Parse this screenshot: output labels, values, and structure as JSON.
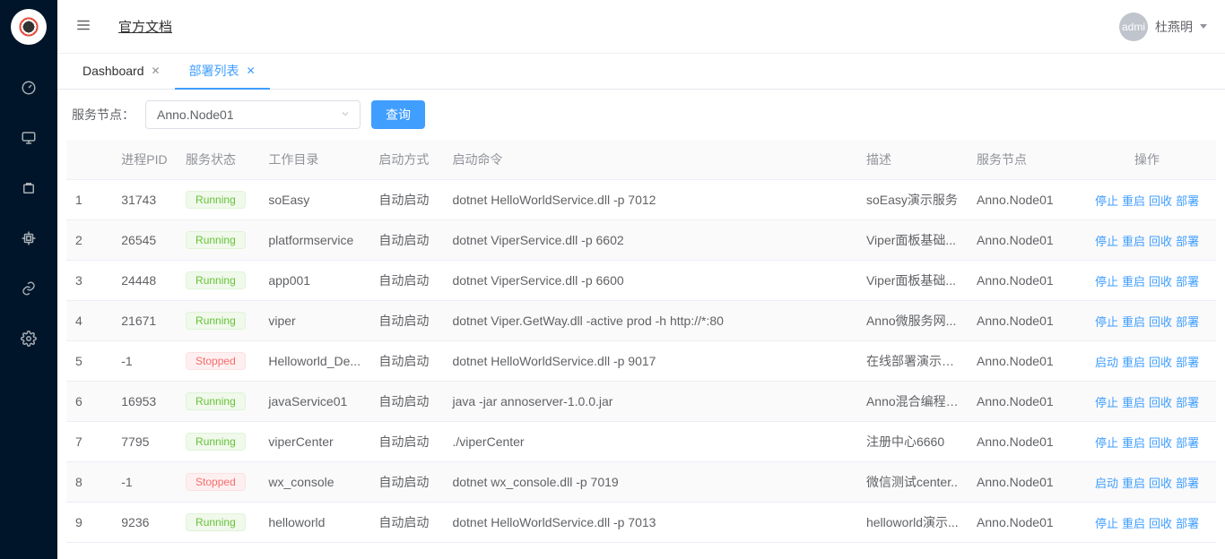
{
  "header": {
    "docs_link": "官方文档",
    "avatar_text": "admi",
    "username": "杜燕明"
  },
  "tabs": [
    {
      "label": "Dashboard",
      "active": false
    },
    {
      "label": "部署列表",
      "active": true
    }
  ],
  "toolbar": {
    "label": "服务节点：",
    "select_value": "Anno.Node01",
    "query_btn": "查询"
  },
  "columns": {
    "idx": "",
    "pid": "进程PID",
    "status": "服务状态",
    "dir": "工作目录",
    "start_type": "启动方式",
    "cmd": "启动命令",
    "desc": "描述",
    "node": "服务节点",
    "actions": "操作"
  },
  "status_labels": {
    "running": "Running",
    "stopped": "Stopped"
  },
  "action_labels": {
    "stop": "停止",
    "start": "启动",
    "restart": "重启",
    "recycle": "回收",
    "deploy": "部署"
  },
  "rows": [
    {
      "idx": "1",
      "pid": "31743",
      "status": "running",
      "dir": "soEasy",
      "start_type": "自动启动",
      "cmd": "dotnet HelloWorldService.dll -p 7012",
      "desc": "soEasy演示服务",
      "node": "Anno.Node01"
    },
    {
      "idx": "2",
      "pid": "26545",
      "status": "running",
      "dir": "platformservice",
      "start_type": "自动启动",
      "cmd": "dotnet ViperService.dll -p 6602",
      "desc": "Viper面板基础...",
      "node": "Anno.Node01"
    },
    {
      "idx": "3",
      "pid": "24448",
      "status": "running",
      "dir": "app001",
      "start_type": "自动启动",
      "cmd": "dotnet ViperService.dll -p 6600",
      "desc": "Viper面板基础...",
      "node": "Anno.Node01"
    },
    {
      "idx": "4",
      "pid": "21671",
      "status": "running",
      "dir": "viper",
      "start_type": "自动启动",
      "cmd": "dotnet Viper.GetWay.dll -active prod -h http://*:80",
      "desc": "Anno微服务网...",
      "node": "Anno.Node01"
    },
    {
      "idx": "5",
      "pid": "-1",
      "status": "stopped",
      "dir": "Helloworld_De...",
      "start_type": "自动启动",
      "cmd": "dotnet HelloWorldService.dll -p 9017",
      "desc": "在线部署演示程序",
      "node": "Anno.Node01"
    },
    {
      "idx": "6",
      "pid": "16953",
      "status": "running",
      "dir": "javaService01",
      "start_type": "自动启动",
      "cmd": "java -jar annoserver-1.0.0.jar",
      "desc": "Anno混合编程J...",
      "node": "Anno.Node01"
    },
    {
      "idx": "7",
      "pid": "7795",
      "status": "running",
      "dir": "viperCenter",
      "start_type": "自动启动",
      "cmd": "./viperCenter",
      "desc": "注册中心6660",
      "node": "Anno.Node01"
    },
    {
      "idx": "8",
      "pid": "-1",
      "status": "stopped",
      "dir": "wx_console",
      "start_type": "自动启动",
      "cmd": "dotnet wx_console.dll -p 7019",
      "desc": "微信测试center..",
      "node": "Anno.Node01"
    },
    {
      "idx": "9",
      "pid": "9236",
      "status": "running",
      "dir": "helloworld",
      "start_type": "自动启动",
      "cmd": "dotnet HelloWorldService.dll -p 7013",
      "desc": "helloworld演示...",
      "node": "Anno.Node01"
    }
  ]
}
